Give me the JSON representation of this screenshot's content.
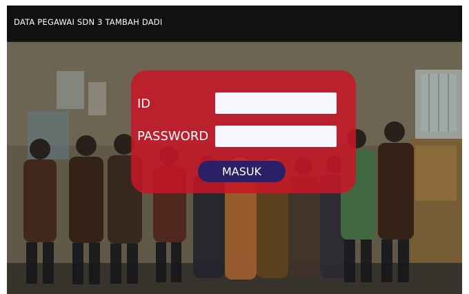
{
  "header": {
    "title": "DATA PEGAWAI SDN 3 TAMBAH DADI"
  },
  "login": {
    "id_label": "ID",
    "id_value": "",
    "password_label": "PASSWORD",
    "password_value": "",
    "submit_label": "MASUK"
  },
  "colors": {
    "header_bg": "#111111",
    "card_bg": "#c81626",
    "button_bg": "#2a2066",
    "field_bg": "#f6f7fd"
  }
}
